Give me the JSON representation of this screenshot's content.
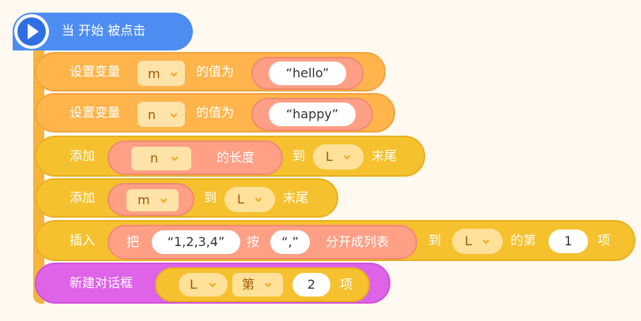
{
  "hat": {
    "label": "当 开始 被点击"
  },
  "blocks": [
    {
      "prefix": "设置变量",
      "var": "m",
      "mid": "的值为",
      "value": "hello"
    },
    {
      "prefix": "设置变量",
      "var": "n",
      "mid": "的值为",
      "value": "happy"
    },
    {
      "prefix": "添加",
      "arg": "n",
      "arg_suffix": "的长度",
      "to": "到",
      "list": "L",
      "suffix": "末尾"
    },
    {
      "prefix": "添加",
      "arg": "m",
      "to": "到",
      "list": "L",
      "suffix": "末尾"
    },
    {
      "prefix": "插入",
      "ba": "把",
      "text": "1,2,3,4",
      "an": "按",
      "sep": ",",
      "split": "分开成列表",
      "to": "到",
      "list": "L",
      "di": "的第",
      "index": "1",
      "xiang": "项"
    },
    {
      "prefix": "新建对话框",
      "list": "L",
      "mode": "第",
      "index": "2",
      "xiang": "项"
    }
  ],
  "colors": {
    "variable": "#ffb54c",
    "list": "#f6c12e",
    "dialog": "#de63e7",
    "hat": "#4d8df2",
    "operator": "#ff9f86"
  },
  "icons": {
    "flag": "play-icon",
    "dropdown": "chevron-down-icon"
  }
}
